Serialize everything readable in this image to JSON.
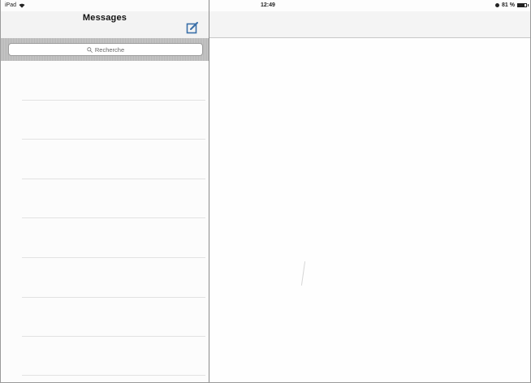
{
  "status_bar": {
    "device": "iPad",
    "time": "12:49",
    "battery": "81 %",
    "battery_level": 0.81
  },
  "master": {
    "title": "Messages",
    "compose_icon": "compose-icon",
    "search": {
      "placeholder": "Recherche",
      "icon": "search-icon"
    },
    "rows": [
      "",
      "",
      "",
      "",
      "",
      "",
      "",
      ""
    ]
  },
  "colors": {
    "navbar": "#f3f3f3",
    "search_bar_bg": "#bdbdbd",
    "compose_accent": "#3a6fa8",
    "separator": "#e2e2e2"
  }
}
